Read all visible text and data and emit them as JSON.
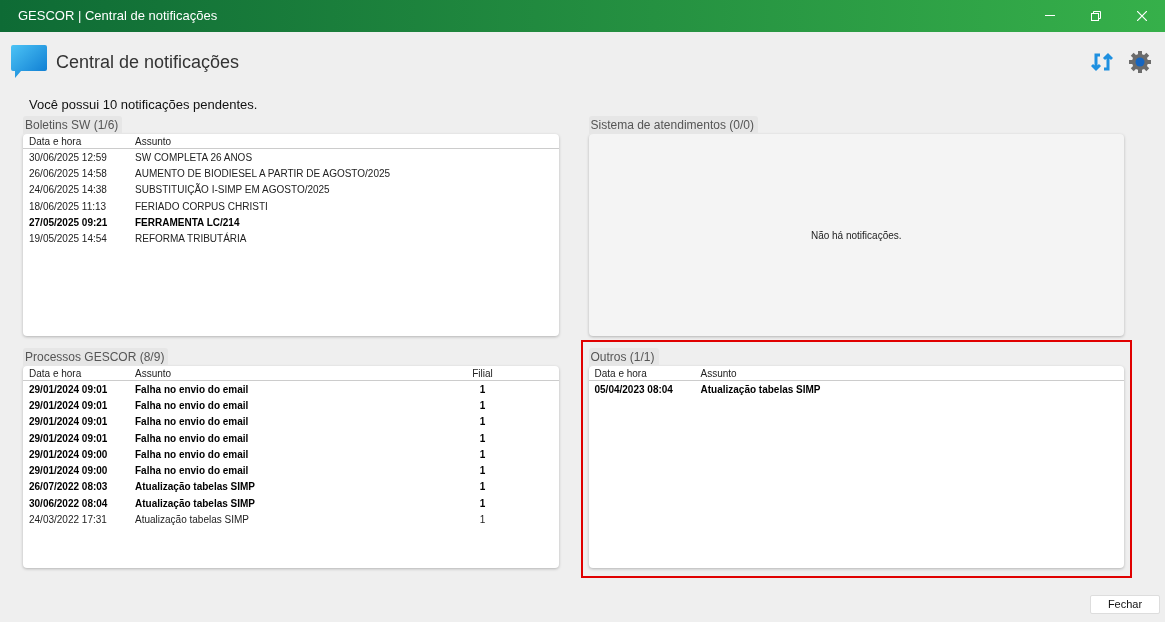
{
  "window": {
    "title": "GESCOR | Central de notificações"
  },
  "header": {
    "title": "Central de notificações"
  },
  "summary": "Você possui 10 notificações pendentes.",
  "panels": [
    {
      "kind": "table",
      "title": "Boletins SW (1/6)",
      "highlighted": false,
      "columns": [
        "Data e hora",
        "Assunto"
      ],
      "rows": [
        {
          "cells": [
            "30/06/2025 12:59",
            "SW COMPLETA 26 ANOS"
          ],
          "unread": false
        },
        {
          "cells": [
            "26/06/2025 14:58",
            "AUMENTO DE BIODIESEL A PARTIR DE AGOSTO/2025"
          ],
          "unread": false
        },
        {
          "cells": [
            "24/06/2025 14:38",
            "SUBSTITUIÇÃO I-SIMP EM AGOSTO/2025"
          ],
          "unread": false
        },
        {
          "cells": [
            "18/06/2025 11:13",
            "FERIADO CORPUS CHRISTI"
          ],
          "unread": false
        },
        {
          "cells": [
            "27/05/2025 09:21",
            "FERRAMENTA LC/214"
          ],
          "unread": true
        },
        {
          "cells": [
            "19/05/2025 14:54",
            "REFORMA TRIBUTÁRIA"
          ],
          "unread": false
        }
      ]
    },
    {
      "kind": "empty",
      "title": "Sistema de atendimentos (0/0)",
      "highlighted": false,
      "message": "Não há notificações."
    },
    {
      "kind": "table",
      "title": "Processos GESCOR (8/9)",
      "highlighted": false,
      "columns": [
        "Data e hora",
        "Assunto",
        "Filial"
      ],
      "rows": [
        {
          "cells": [
            "29/01/2024 09:01",
            "Falha no envio do email",
            "1"
          ],
          "unread": true
        },
        {
          "cells": [
            "29/01/2024 09:01",
            "Falha no envio do email",
            "1"
          ],
          "unread": true
        },
        {
          "cells": [
            "29/01/2024 09:01",
            "Falha no envio do email",
            "1"
          ],
          "unread": true
        },
        {
          "cells": [
            "29/01/2024 09:01",
            "Falha no envio do email",
            "1"
          ],
          "unread": true
        },
        {
          "cells": [
            "29/01/2024 09:00",
            "Falha no envio do email",
            "1"
          ],
          "unread": true
        },
        {
          "cells": [
            "29/01/2024 09:00",
            "Falha no envio do email",
            "1"
          ],
          "unread": true
        },
        {
          "cells": [
            "26/07/2022 08:03",
            "Atualização tabelas SIMP",
            "1"
          ],
          "unread": true
        },
        {
          "cells": [
            "30/06/2022 08:04",
            "Atualização tabelas SIMP",
            "1"
          ],
          "unread": true
        },
        {
          "cells": [
            "24/03/2022 17:31",
            "Atualização tabelas SIMP",
            "1"
          ],
          "unread": false
        }
      ]
    },
    {
      "kind": "table",
      "title": "Outros (1/1)",
      "highlighted": true,
      "columns": [
        "Data e hora",
        "Assunto"
      ],
      "rows": [
        {
          "cells": [
            "05/04/2023 08:04",
            "Atualização tabelas SIMP"
          ],
          "unread": true
        }
      ]
    }
  ],
  "buttons": [
    "Fechar"
  ]
}
